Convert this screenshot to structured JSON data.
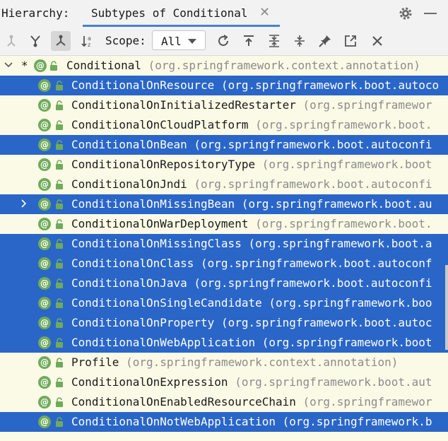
{
  "header": {
    "hierarchy_label": "Hierarchy:",
    "tab_label": "Subtypes of Conditional",
    "close_icon": "close-icon",
    "settings_icon": "gear-icon",
    "minimize_icon": "minimize-icon"
  },
  "toolbar": {
    "scope_label": "Scope:",
    "scope_value": "All",
    "buttons": [
      "supertypes-hierarchy-icon",
      "subtypes-hierarchy-icon",
      "class-hierarchy-icon",
      "sort-alphabetically-icon",
      "refresh-icon",
      "export-icon",
      "expand-all-icon",
      "collapse-all-icon",
      "pin-icon",
      "open-in-new-tab-icon",
      "close-icon"
    ]
  },
  "tree": {
    "root": {
      "name": "Conditional",
      "pkg": "(org.springframework.context.annotation)"
    },
    "rows": [
      {
        "name": "ConditionalOnResource",
        "pkg": "(org.springframework.boot.autoco",
        "selected": true
      },
      {
        "name": "ConditionalOnInitializedRestarter",
        "pkg": "(org.springframewor",
        "selected": false
      },
      {
        "name": "ConditionalOnCloudPlatform",
        "pkg": "(org.springframework.boot.",
        "selected": false
      },
      {
        "name": "ConditionalOnBean",
        "pkg": "(org.springframework.boot.autoconfi",
        "selected": true
      },
      {
        "name": "ConditionalOnRepositoryType",
        "pkg": "(org.springframework.boot",
        "selected": false
      },
      {
        "name": "ConditionalOnJndi",
        "pkg": "(org.springframework.boot.autoconfi",
        "selected": false
      },
      {
        "name": "ConditionalOnMissingBean",
        "pkg": "(org.springframework.boot.au",
        "selected": true,
        "expandable": true
      },
      {
        "name": "ConditionalOnWarDeployment",
        "pkg": "(org.springframework.boot.",
        "selected": false
      },
      {
        "name": "ConditionalOnMissingClass",
        "pkg": "(org.springframework.boot.a",
        "selected": true
      },
      {
        "name": "ConditionalOnClass",
        "pkg": "(org.springframework.boot.autoconf",
        "selected": true
      },
      {
        "name": "ConditionalOnJava",
        "pkg": "(org.springframework.boot.autoconfi",
        "selected": true
      },
      {
        "name": "ConditionalOnSingleCandidate",
        "pkg": "(org.springframework.boo",
        "selected": true
      },
      {
        "name": "ConditionalOnProperty",
        "pkg": "(org.springframework.boot.autoc",
        "selected": true
      },
      {
        "name": "ConditionalOnWebApplication",
        "pkg": "(org.springframework.boot",
        "selected": true
      },
      {
        "name": "Profile",
        "pkg": "(org.springframework.context.annotation)",
        "selected": false
      },
      {
        "name": "ConditionalOnExpression",
        "pkg": "(org.springframework.boot.aut",
        "selected": false
      },
      {
        "name": "ConditionalOnEnabledResourceChain",
        "pkg": "(org.springframewor",
        "selected": false
      },
      {
        "name": "ConditionalOnNotWebApplication",
        "pkg": "(org.springframework.b",
        "selected": true
      }
    ]
  },
  "colors": {
    "selection": "#2a66c8",
    "tab_underline": "#4a82c8",
    "annotation_icon": "#6fab5a"
  }
}
